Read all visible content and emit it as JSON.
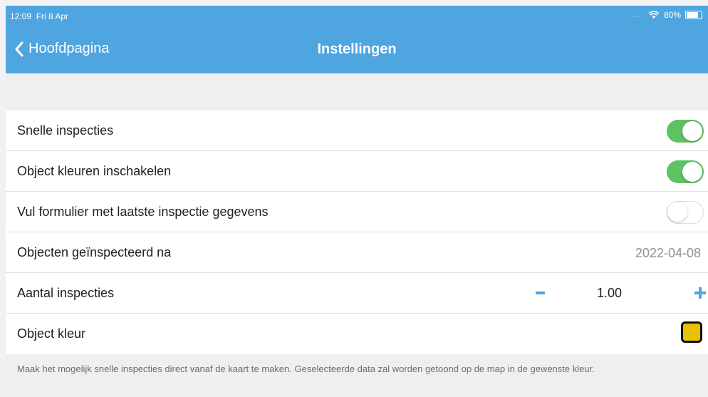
{
  "status_bar": {
    "time": "12:09",
    "date": "Fri 8 Apr",
    "signal": "....",
    "battery": "80%"
  },
  "nav": {
    "back_label": "Hoofdpagina",
    "title": "Instellingen"
  },
  "settings": {
    "snelle_inspecties": {
      "label": "Snelle inspecties",
      "enabled": true
    },
    "object_kleuren": {
      "label": "Object kleuren inschakelen",
      "enabled": true
    },
    "vul_formulier": {
      "label": "Vul formulier met laatste inspectie gegevens",
      "enabled": false
    },
    "objecten_na": {
      "label": "Objecten geïnspecteerd na",
      "value": "2022-04-08"
    },
    "aantal": {
      "label": "Aantal inspecties",
      "value": "1.00"
    },
    "object_kleur": {
      "label": "Object kleur",
      "color": "#e6c200"
    }
  },
  "footer": {
    "text": "Maak het mogelijk snelle inspecties direct vanaf de kaart te maken. Geselecteerde data zal worden getoond op de map in de gewenste kleur."
  },
  "colors": {
    "accent": "#4ea5df",
    "toggle_on": "#5cc262"
  }
}
